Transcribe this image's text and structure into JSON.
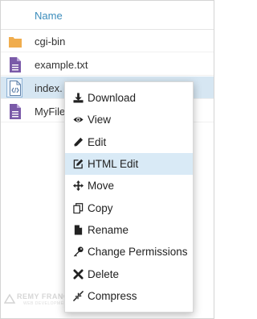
{
  "header": {
    "name_label": "Name"
  },
  "files": [
    {
      "name": "cgi-bin",
      "icon": "folder-icon",
      "selected": false
    },
    {
      "name": "example.txt",
      "icon": "text-file-icon",
      "selected": false
    },
    {
      "name": "index.",
      "icon": "code-file-icon",
      "selected": true
    },
    {
      "name": "MyFile",
      "icon": "text-file-icon",
      "selected": false
    }
  ],
  "context_menu": {
    "items": [
      {
        "label": "Download",
        "icon": "download-icon"
      },
      {
        "label": "View",
        "icon": "eye-icon"
      },
      {
        "label": "Edit",
        "icon": "pencil-icon"
      },
      {
        "label": "HTML Edit",
        "icon": "edit-square-icon",
        "active": true
      },
      {
        "label": "Move",
        "icon": "move-arrows-icon"
      },
      {
        "label": "Copy",
        "icon": "copy-icon"
      },
      {
        "label": "Rename",
        "icon": "file-icon"
      },
      {
        "label": "Change Permissions",
        "icon": "key-icon"
      },
      {
        "label": "Delete",
        "icon": "close-icon"
      },
      {
        "label": "Compress",
        "icon": "compress-icon"
      }
    ]
  },
  "watermark": {
    "main": "REMY FRANCOIS",
    "sub": "WEB DEVELOPMENT"
  },
  "colors": {
    "accent": "#3c8dbc",
    "folder": "#f0ad4e",
    "file": "#7a5aa8",
    "selected_row": "#d6e6f2",
    "menu_active": "#d9eaf6"
  }
}
